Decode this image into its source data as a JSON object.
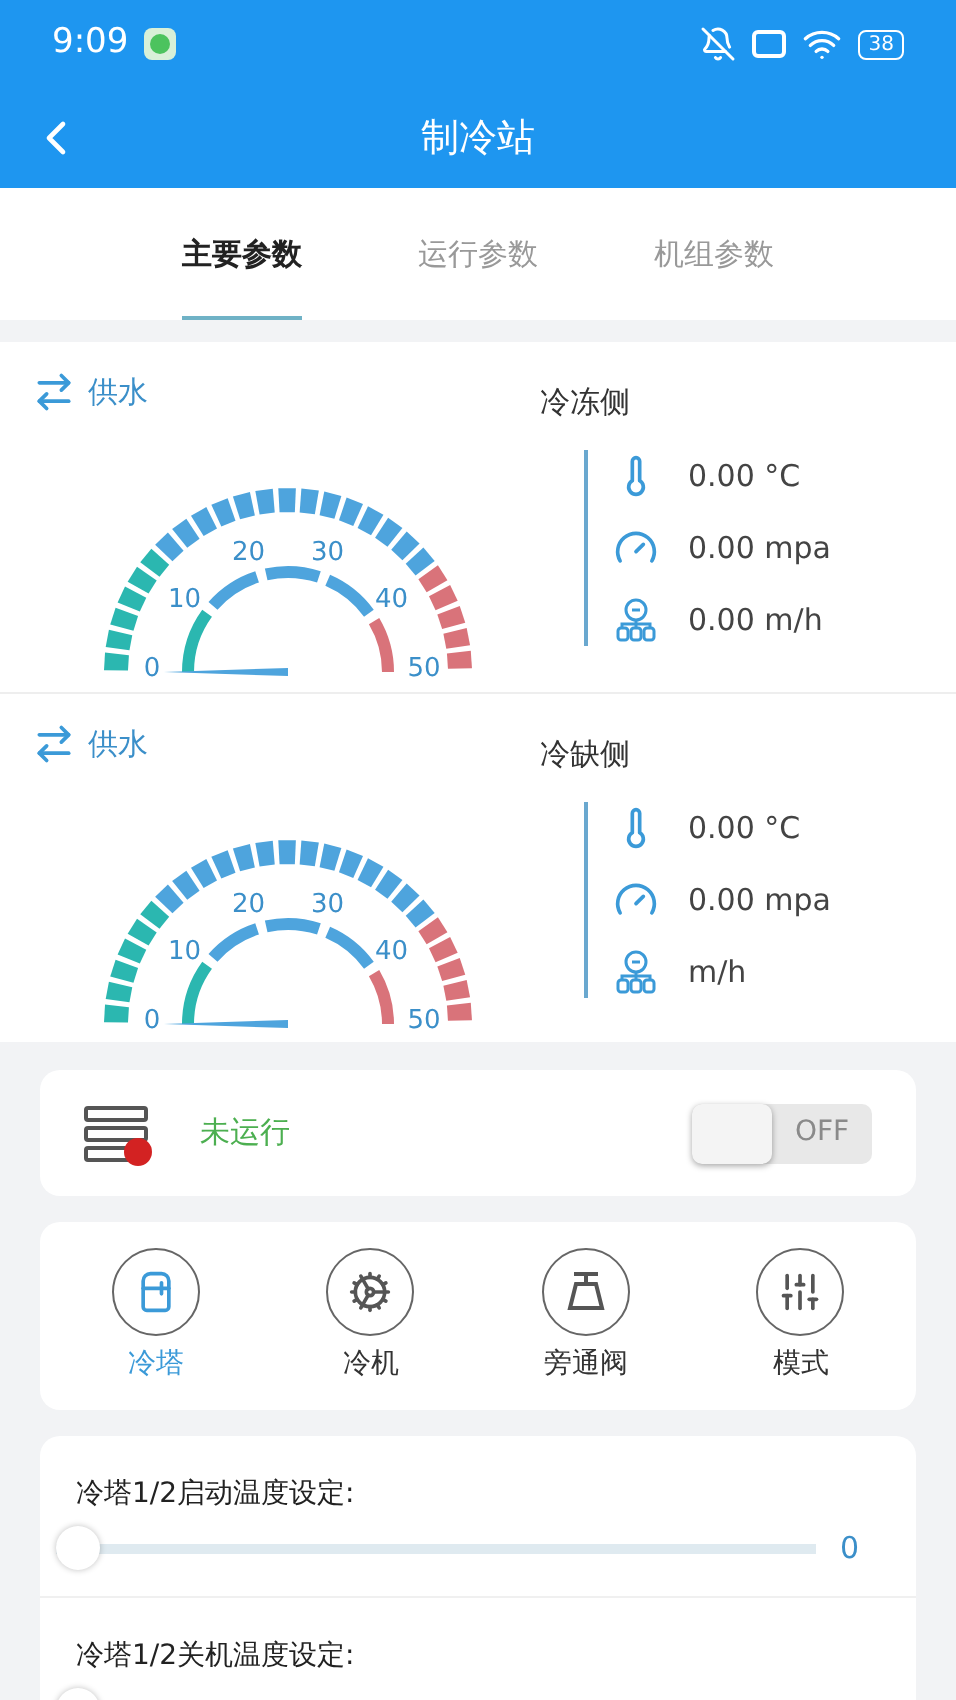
{
  "status_bar": {
    "time": "9:09",
    "battery": "38"
  },
  "header": {
    "title": "制冷站"
  },
  "tabs": [
    {
      "label": "主要参数",
      "selected": true
    },
    {
      "label": "运行参数",
      "selected": false
    },
    {
      "label": "机组参数",
      "selected": false
    }
  ],
  "sections": [
    {
      "gauge_label": "供水",
      "scale_labels": [
        "0",
        "10",
        "20",
        "30",
        "40",
        "50"
      ],
      "side_title": "冷冻侧",
      "readings": [
        {
          "kind": "temperature",
          "text": "0.00 °C"
        },
        {
          "kind": "pressure",
          "text": "0.00 mpa"
        },
        {
          "kind": "flow",
          "text": "0.00 m/h"
        }
      ]
    },
    {
      "gauge_label": "供水",
      "scale_labels": [
        "0",
        "10",
        "20",
        "30",
        "40",
        "50"
      ],
      "side_title": "冷缺侧",
      "readings": [
        {
          "kind": "temperature",
          "text": "0.00 °C"
        },
        {
          "kind": "pressure",
          "text": "0.00 mpa"
        },
        {
          "kind": "flow",
          "text": "m/h"
        }
      ]
    }
  ],
  "run_status": {
    "text": "未运行",
    "on": false,
    "switch_label": "OFF"
  },
  "nav": [
    {
      "label": "冷塔",
      "selected": true
    },
    {
      "label": "冷机",
      "selected": false
    },
    {
      "label": "旁通阀",
      "selected": false
    },
    {
      "label": "模式",
      "selected": false
    }
  ],
  "sliders": [
    {
      "label": "冷塔1/2启动温度设定:",
      "level": 0,
      "value": "0"
    },
    {
      "label": "冷塔1/2关机温度设定:",
      "level": 0
    }
  ]
}
